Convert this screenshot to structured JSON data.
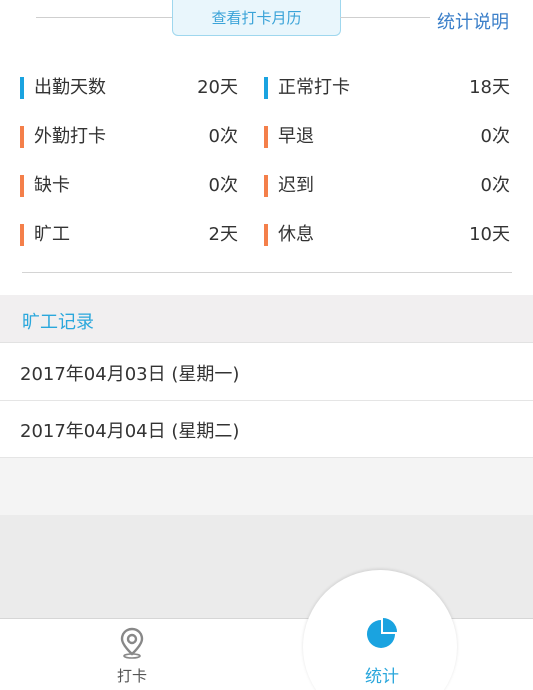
{
  "header": {
    "calendar_button": "查看打卡月历",
    "explain_link": "统计说明"
  },
  "stats": [
    {
      "left": {
        "label": "出勤天数",
        "value": "20天",
        "color": "#1aa3e0"
      },
      "right": {
        "label": "正常打卡",
        "value": "18天",
        "color": "#1aa3e0"
      }
    },
    {
      "left": {
        "label": "外勤打卡",
        "value": "0次",
        "color": "#f47f4a"
      },
      "right": {
        "label": "早退",
        "value": "0次",
        "color": "#f47f4a"
      }
    },
    {
      "left": {
        "label": "缺卡",
        "value": "0次",
        "color": "#f47f4a"
      },
      "right": {
        "label": "迟到",
        "value": "0次",
        "color": "#f47f4a"
      }
    },
    {
      "left": {
        "label": "旷工",
        "value": "2天",
        "color": "#f47f4a"
      },
      "right": {
        "label": "休息",
        "value": "10天",
        "color": "#f47f4a"
      }
    }
  ],
  "absence": {
    "title": "旷工记录",
    "records": [
      "2017年04月03日 (星期一)",
      "2017年04月04日 (星期二)"
    ]
  },
  "tabbar": {
    "left": {
      "label": "打卡",
      "icon": "location-pin-icon"
    },
    "right": {
      "label": "统计",
      "icon": "pie-chart-icon",
      "active": true
    }
  },
  "colors": {
    "accent": "#2aa7dc",
    "warning": "#f47f4a"
  }
}
